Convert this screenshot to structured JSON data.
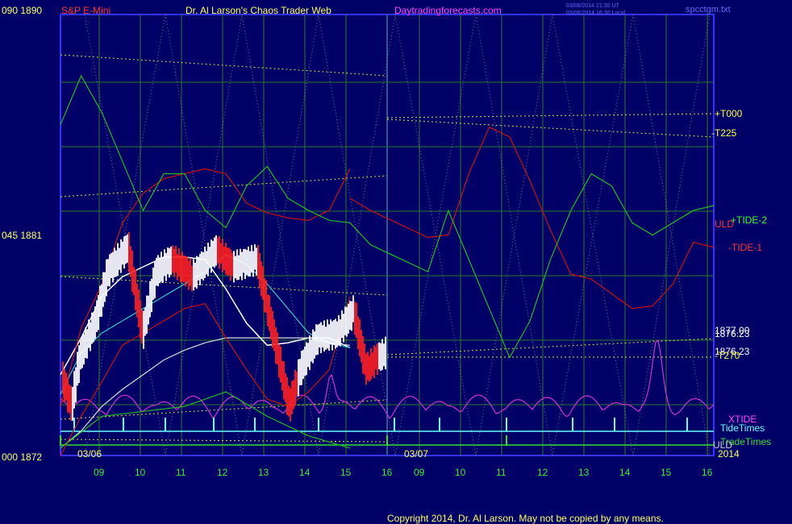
{
  "header": {
    "y_top_label": "090  1890",
    "instrument": "S&P E-Mini",
    "title": "Dr. Al Larson's Chaos Trader Web",
    "site": "Daytradingforecasts.com",
    "time_utc": "03/06/2014 21:30 UT",
    "time_local": "03/06/2014 16:30 Local",
    "file": "spcctgm.txt"
  },
  "footer": {
    "copyright": "Copyright 2014, Dr. Al Larson. May not be copied by any means."
  },
  "colors": {
    "background": "#000066",
    "plot_border": "#3333ff",
    "grid": "#2a7a2a",
    "price_up": "#ffffff",
    "price_down": "#ff2020",
    "red_band": "#cc1010",
    "green_line": "#22bb22",
    "cyan": "#33cccc",
    "magenta": "#cc33cc",
    "yellow_dotted": "#dddd44",
    "tide_times": "#66ffff",
    "trade_times": "#33dd33",
    "axis_text": "#33ee33"
  },
  "chart_data": {
    "type": "line",
    "title": "S&P E-Mini",
    "y_axis_labels": [
      {
        "value": 1890,
        "text": "090  1890"
      },
      {
        "value": 1881,
        "text": "045  1881"
      },
      {
        "value": 1872,
        "text": "000  1872"
      }
    ],
    "ylim": [
      1872,
      1890
    ],
    "x_hour_labels": [
      "09",
      "10",
      "11",
      "12",
      "13",
      "14",
      "15",
      "16",
      "09",
      "10",
      "11",
      "12",
      "13",
      "14",
      "15",
      "16"
    ],
    "date_labels": [
      "03/06",
      "03/07",
      "2014"
    ],
    "right_labels": [
      {
        "text": "+T000",
        "color": "#ffff44"
      },
      {
        "text": "-T225",
        "color": "#ffff44"
      },
      {
        "text": "ULD",
        "color": "#ff3333"
      },
      {
        "text": "+TIDE-2",
        "color": "#33ff33"
      },
      {
        "text": "-TIDE-1",
        "color": "#ff3333"
      },
      {
        "text": "1877.00",
        "color": "#ffffff"
      },
      {
        "text": "1876.23",
        "color": "#ffffff"
      },
      {
        "text": "-T270",
        "color": "#ffff44"
      },
      {
        "text": "XTIDE",
        "color": "#ff44ff"
      },
      {
        "text": "TideTimes",
        "color": "#66ffff"
      },
      {
        "text": "TradeTimes",
        "color": "#33dd33"
      },
      {
        "text": "ULD",
        "color": "#cccccc"
      }
    ],
    "series": [
      {
        "color": "#ffffff",
        "x": [
          0,
          0.5,
          1,
          1.5,
          2,
          2.5,
          3,
          3.5,
          4,
          4.5,
          5,
          5.5,
          6,
          6.5,
          7
        ],
        "values": [
          1875.3,
          1876.8,
          1878.5,
          1879.3,
          1879.7,
          1880.1,
          1880.1,
          1880.0,
          1878.8,
          1877.4,
          1876.5,
          1876.6,
          1876.8,
          1876.8,
          1876.4
        ]
      },
      {
        "color": "#33cccc",
        "x": [
          0,
          0.5,
          1,
          1.5,
          2,
          2.5,
          3,
          3.5,
          4,
          4.5,
          5,
          5.5,
          6,
          6.5,
          7
        ],
        "values": [
          1874.5,
          1876.2,
          1877.0,
          1877.5,
          1878.0,
          1878.5,
          1879.0,
          1879.5,
          1880.2,
          1879.8,
          1879.0,
          1878.0,
          1877.0,
          1876.6,
          1876.4
        ]
      },
      {
        "color": "#dddddd",
        "x": [
          0,
          0.5,
          1,
          1.5,
          2,
          2.5,
          3,
          3.5,
          4,
          4.5,
          5,
          5.5,
          6,
          6.5,
          7
        ],
        "values": [
          1872.3,
          1873.0,
          1874.0,
          1874.7,
          1875.3,
          1875.9,
          1876.3,
          1876.6,
          1876.8,
          1876.8,
          1876.8,
          1876.8,
          1876.8,
          1876.6,
          1876.5
        ]
      },
      {
        "color": "#cc1010",
        "x": [
          0,
          0.5,
          1,
          1.5,
          2,
          2.5,
          3,
          3.5,
          4,
          4.5,
          5,
          5.5,
          6,
          6.5,
          7
        ],
        "values": [
          1874.0,
          1877.2,
          1879.0,
          1881.5,
          1882.7,
          1883.3,
          1883.5,
          1883.7,
          1883.5,
          1882.3,
          1881.9,
          1881.7,
          1881.6,
          1882.0,
          1883.7
        ]
      },
      {
        "color": "#cc1010",
        "x": [
          0,
          0.5,
          1,
          1.5,
          2,
          2.5,
          3,
          3.5,
          4,
          4.5,
          5,
          5.5,
          6,
          6.5,
          7
        ],
        "values": [
          1872.0,
          1873.6,
          1875.0,
          1876.5,
          1877.0,
          1877.5,
          1878.0,
          1878.2,
          1876.8,
          1875.5,
          1874.3,
          1874.0,
          1874.6,
          1875.5,
          1878.5
        ]
      },
      {
        "color": "#cc1010",
        "x": [
          7,
          7.5,
          8,
          8.5,
          9,
          9.5,
          10,
          10.5,
          11,
          11.5,
          12,
          12.5,
          13,
          13.5,
          14,
          14.5,
          15
        ],
        "values": [
          1882.5,
          1882.0,
          1880.9,
          1881.0,
          1883.5,
          1885.4,
          1885.0,
          1883.2,
          1881.2,
          1879.4,
          1879.2,
          1878.6,
          1878.0,
          1878.1,
          1879.0,
          1880.7,
          1880.5
        ]
      },
      {
        "color": "#22bb22",
        "x": [
          0,
          0.5,
          1,
          1.5,
          2,
          2.5,
          3,
          3.5,
          4,
          4.5,
          5,
          5.5,
          6,
          6.5,
          7,
          7.5,
          8,
          8.5,
          9,
          9.5,
          10,
          10.5,
          11,
          11.5,
          12,
          12.5,
          13,
          13.5,
          14,
          14.5,
          15
        ],
        "values": [
          1885.5,
          1887.5,
          1886.0,
          1884.0,
          1882.0,
          1883.5,
          1883.5,
          1882.0,
          1881.3,
          1883.0,
          1883.8,
          1882.5,
          1882.0,
          1881.6,
          1881.5,
          1880.6,
          1879.5,
          1882.0,
          1880.0,
          1878.0,
          1876.0,
          1877.5,
          1880.0,
          1882.0,
          1883.5,
          1883.0,
          1881.5,
          1881.0,
          1881.5,
          1882.0,
          1882.2
        ]
      },
      {
        "color": "#22bb22",
        "x": [
          0,
          1,
          2,
          3,
          4,
          5,
          6,
          7
        ],
        "values": [
          1872.3,
          1873.6,
          1873.8,
          1874.0,
          1874.6,
          1873.6,
          1872.8,
          1872.3
        ]
      }
    ]
  }
}
